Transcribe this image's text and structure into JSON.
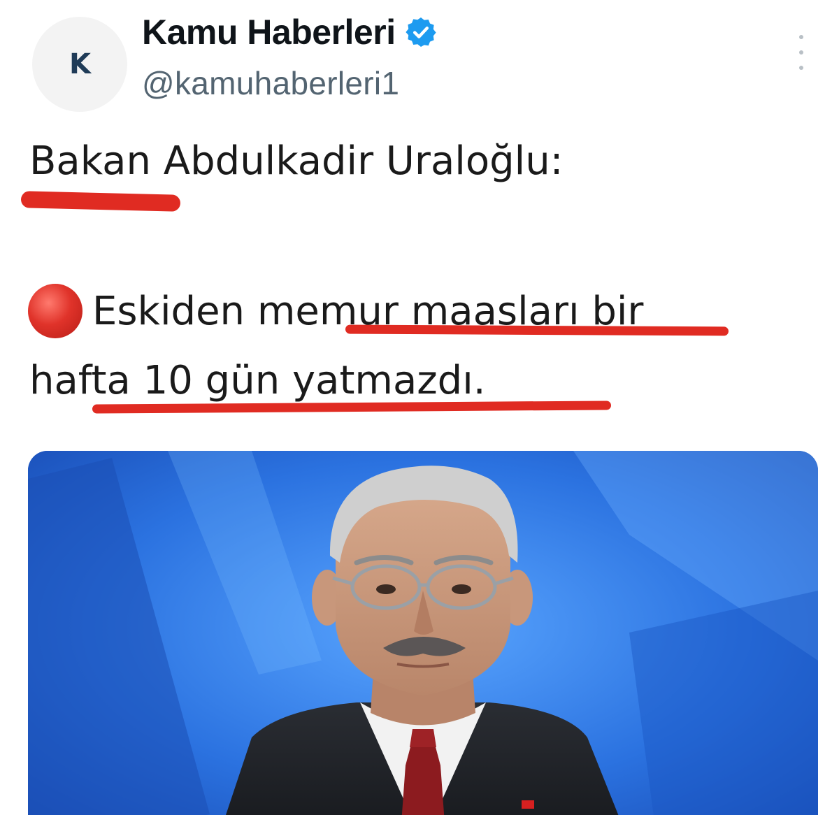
{
  "author": {
    "avatar_initial": "K",
    "display_name": "Kamu Haberleri",
    "handle": "@kamuhaberleri1",
    "verified": true
  },
  "tweet": {
    "line1": "Bakan Abdulkadir Uraloğlu:",
    "line2": "Eskiden memur maasları bir",
    "line3": "hafta 10 gün yatmazdı."
  },
  "icons": {
    "bullet": "red-circle-icon",
    "verified": "verified-badge-icon",
    "more": "more-options-icon"
  },
  "colors": {
    "underline": "#e02b22",
    "verified": "#1d9bf0",
    "handle": "#536471",
    "media_bg": "#2f7be8"
  }
}
